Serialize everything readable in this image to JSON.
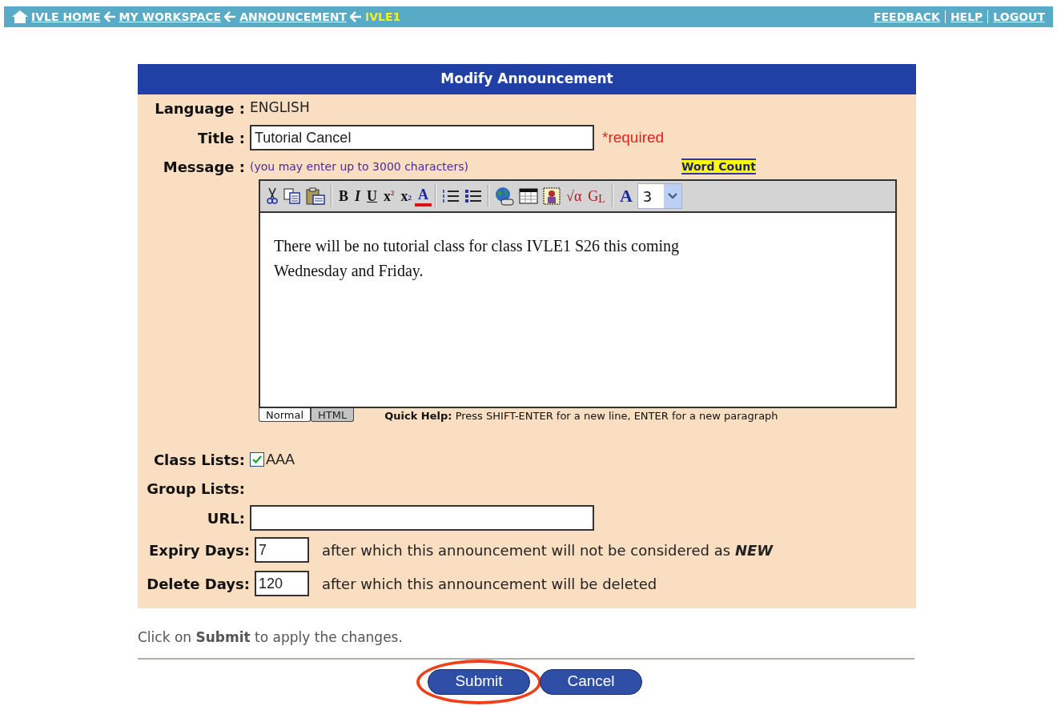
{
  "nav": {
    "crumbs": [
      {
        "label": "IVLE HOME",
        "current": false
      },
      {
        "label": "MY WORKSPACE",
        "current": false
      },
      {
        "label": "ANNOUNCEMENT",
        "current": false
      },
      {
        "label": "IVLE1",
        "current": true
      }
    ],
    "links": [
      "FEEDBACK",
      "HELP",
      "LOGOUT"
    ]
  },
  "form": {
    "title": "Modify Announcement",
    "language": {
      "label": "Language :",
      "value": "ENGLISH"
    },
    "title_field": {
      "label": "Title :",
      "value": "Tutorial Cancel",
      "required": "*required"
    },
    "message": {
      "label": "Message :",
      "hint": "(you may enter up to 3000 characters)",
      "word_count": "Word Count",
      "toolbar": [
        {
          "kind": "cut"
        },
        {
          "kind": "copy"
        },
        {
          "kind": "paste"
        },
        {
          "kind": "sep"
        },
        {
          "kind": "bold",
          "glyph": "B"
        },
        {
          "kind": "italic",
          "glyph": "I"
        },
        {
          "kind": "underline",
          "glyph": "U"
        },
        {
          "kind": "superscript",
          "glyph": "x",
          "sub": "2"
        },
        {
          "kind": "subscript",
          "glyph": "x",
          "sub": "2"
        },
        {
          "kind": "color",
          "glyph": "A"
        },
        {
          "kind": "sep"
        },
        {
          "kind": "ordered-list"
        },
        {
          "kind": "bullet-list"
        },
        {
          "kind": "sep"
        },
        {
          "kind": "globe"
        },
        {
          "kind": "table"
        },
        {
          "kind": "image"
        },
        {
          "kind": "math",
          "glyph": "√α"
        },
        {
          "kind": "glossary",
          "glyph": "G",
          "sub": "L"
        },
        {
          "kind": "sep"
        },
        {
          "kind": "font",
          "glyph": "A"
        }
      ],
      "font_size": "3",
      "body": "There will be no tutorial class for class IVLE1 S26 this coming Wednesday and Friday.",
      "tabs": [
        {
          "label": "Normal",
          "selected": true
        },
        {
          "label": "HTML",
          "selected": false
        }
      ],
      "quick_help_label": "Quick Help:",
      "quick_help": "Press SHIFT-ENTER for a new  line, ENTER for a new paragraph"
    },
    "class_lists": {
      "label": "Class Lists:",
      "items": [
        {
          "label": "AAA",
          "checked": true
        }
      ]
    },
    "group_lists": {
      "label": "Group Lists:"
    },
    "url": {
      "label": "URL:"
    },
    "expiry": {
      "label": "Expiry Days:",
      "value": "7",
      "note": "after which this announcement will not be considered as **NEW**"
    },
    "delete": {
      "label": "Delete Days:",
      "value": "120",
      "note": "after which this announcement will be deleted"
    }
  },
  "instruction": "Click on **Submit** to apply the changes.",
  "buttons": [
    {
      "label": "Submit",
      "highlighted": true
    },
    {
      "label": "Cancel",
      "highlighted": false
    }
  ]
}
